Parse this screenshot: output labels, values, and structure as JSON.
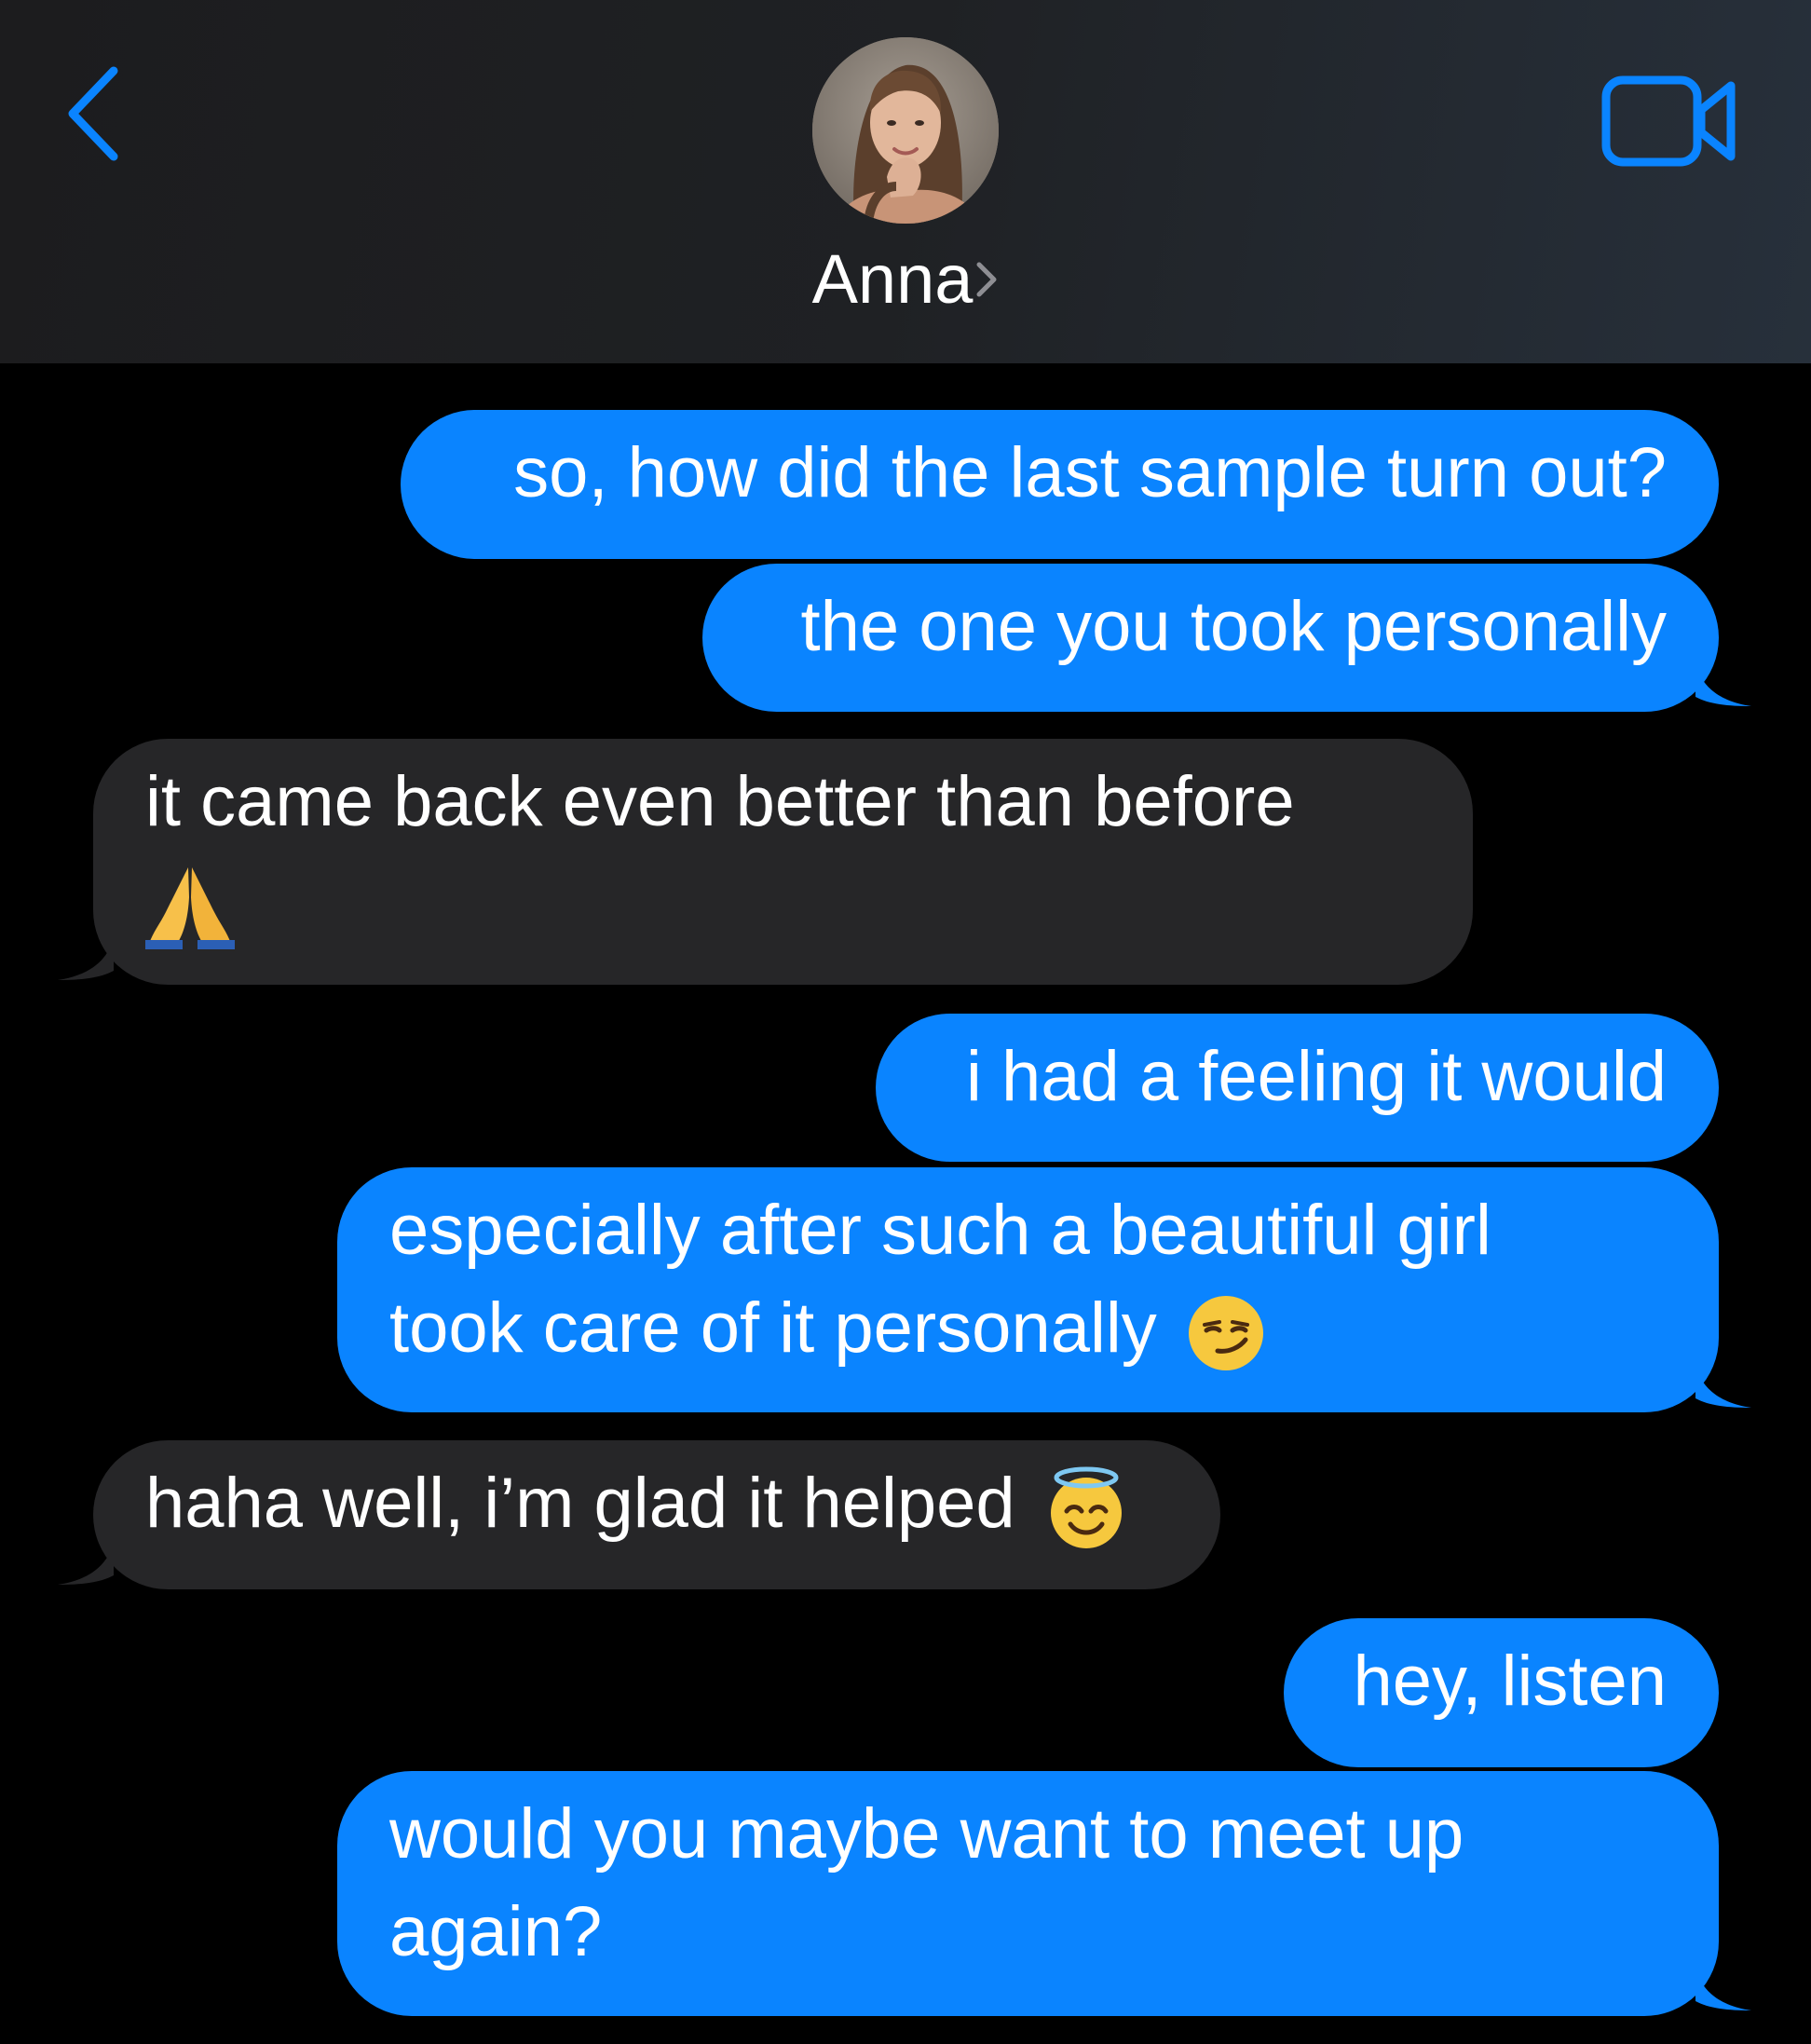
{
  "contact": {
    "name": "Anna",
    "avatar": "contact-photo"
  },
  "header": {
    "back_icon": "chevron-left-icon",
    "video_icon": "video-camera-icon",
    "accent_color": "#0a84ff"
  },
  "colors": {
    "sent_bubble": "#0a84ff",
    "received_bubble": "#262628",
    "background": "#000000"
  },
  "messages": [
    {
      "direction": "sent",
      "lines": [
        "so, how did the last sample turn out?"
      ]
    },
    {
      "direction": "sent",
      "lines": [
        "the one you took personally"
      ]
    },
    {
      "direction": "received",
      "lines": [
        "it came back even better than before"
      ],
      "emoji": "folded-hands"
    },
    {
      "direction": "sent",
      "lines": [
        "i had a feeling it would"
      ]
    },
    {
      "direction": "sent",
      "lines": [
        "especially after such a beautiful girl",
        "took care of it personally"
      ],
      "emoji": "smirking-face"
    },
    {
      "direction": "received",
      "lines": [
        "haha well, i’m glad it helped"
      ],
      "emoji": "smiling-face-with-halo"
    },
    {
      "direction": "sent",
      "lines": [
        "hey, listen"
      ]
    },
    {
      "direction": "sent",
      "lines": [
        "would you maybe want to meet up",
        "again?"
      ]
    }
  ]
}
